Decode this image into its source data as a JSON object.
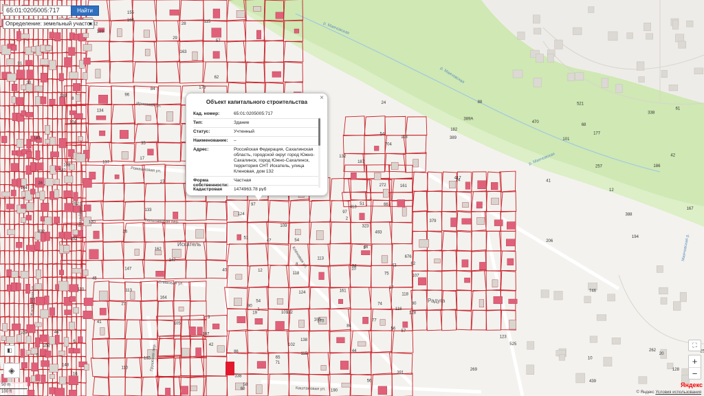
{
  "search": {
    "value": "65:01:0205005:717",
    "button": "Найти"
  },
  "mode_select": {
    "value": "Определение: земельный участок"
  },
  "popup": {
    "title": "Объект капитального строительства",
    "rows": [
      {
        "key": "Кад. номер:",
        "value": "65:01:0205005:717"
      },
      {
        "key": "Тип:",
        "value": "Здание"
      },
      {
        "key": "Статус:",
        "value": "Учтенный"
      },
      {
        "key": "Наименование:",
        "value": "–"
      },
      {
        "key": "Адрес:",
        "value": "Российская Федерация, Сахалинская область, городской округ город Южно-Сахалинск, город Южно-Сахалинск, территория СНТ Искатель, улица Кленовая, дом 132"
      },
      {
        "key": "Форма собственности:",
        "value": "Частная"
      },
      {
        "key": "Кадастровая стоимость:",
        "value": "1474963.78 руб"
      }
    ]
  },
  "map": {
    "streets": [
      "Ирисовая ул.",
      "Ромашковая ул.",
      "Вишнёвая ул.",
      "Кленовая ул.",
      "Сливовая ул.",
      "Каштановая ул.",
      "Грушевая пер.",
      "Тюльпановая пер.",
      "Жасминовая ул."
    ],
    "river_labels": [
      "р. Маячовская",
      "р. Маячовская",
      "р. Маячовская",
      "Маячовская р."
    ],
    "area_labels": [
      "Искатель",
      "Радуга"
    ],
    "parcel_numbers": [
      "148",
      "163",
      "110",
      "142",
      "155",
      "162",
      "161",
      "139",
      "782",
      "45",
      "145",
      "144",
      "27",
      "54",
      "30",
      "62",
      "96",
      "164",
      "168",
      "104",
      "133",
      "42",
      "3",
      "46",
      "12",
      "29",
      "28",
      "6",
      "26",
      "27",
      "40",
      "134",
      "108",
      "105",
      "107",
      "88",
      "135",
      "147",
      "16",
      "41",
      "84",
      "115",
      "110",
      "113",
      "130",
      "152",
      "26",
      "105",
      "91",
      "57",
      "8",
      "9",
      "332",
      "189",
      "170",
      "137",
      "147",
      "17",
      "108",
      "35",
      "44",
      "34",
      "124",
      "138",
      "109",
      "118",
      "90",
      "112",
      "75",
      "19",
      "97",
      "65",
      "493",
      "86",
      "66",
      "170",
      "54",
      "62",
      "113",
      "105",
      "124",
      "54",
      "10",
      "101",
      "77",
      "102",
      "51",
      "56",
      "323",
      "46",
      "115",
      "71",
      "97",
      "80",
      "47",
      "60",
      "118",
      "118",
      "8",
      "190",
      "1",
      "17",
      "12",
      "128",
      "57",
      "58",
      "338",
      "43",
      "2",
      "1",
      "84",
      "118",
      "10",
      "12",
      "51",
      "132",
      "24",
      "101",
      "123",
      "24",
      "56",
      "182",
      "525",
      "161",
      "167",
      "177",
      "470",
      "439",
      "704",
      "413",
      "186",
      "272",
      "20",
      "194",
      "258",
      "269",
      "338",
      "187",
      "262",
      "417",
      "746",
      "521",
      "206",
      "676",
      "74",
      "61",
      "42",
      "41",
      "257",
      "391",
      "389A",
      "379",
      "389",
      "388",
      "128",
      "68",
      "107"
    ],
    "zone_labels": [
      "20",
      "100",
      "40",
      "87",
      "62"
    ]
  },
  "zoom": {
    "plus": "+",
    "minus": "−"
  },
  "attribution": {
    "brand": "Яндекс",
    "copy": "© Яндекс",
    "terms": "Условия использования"
  },
  "scale": {
    "line1": "50 m",
    "line2": "100 ft"
  }
}
